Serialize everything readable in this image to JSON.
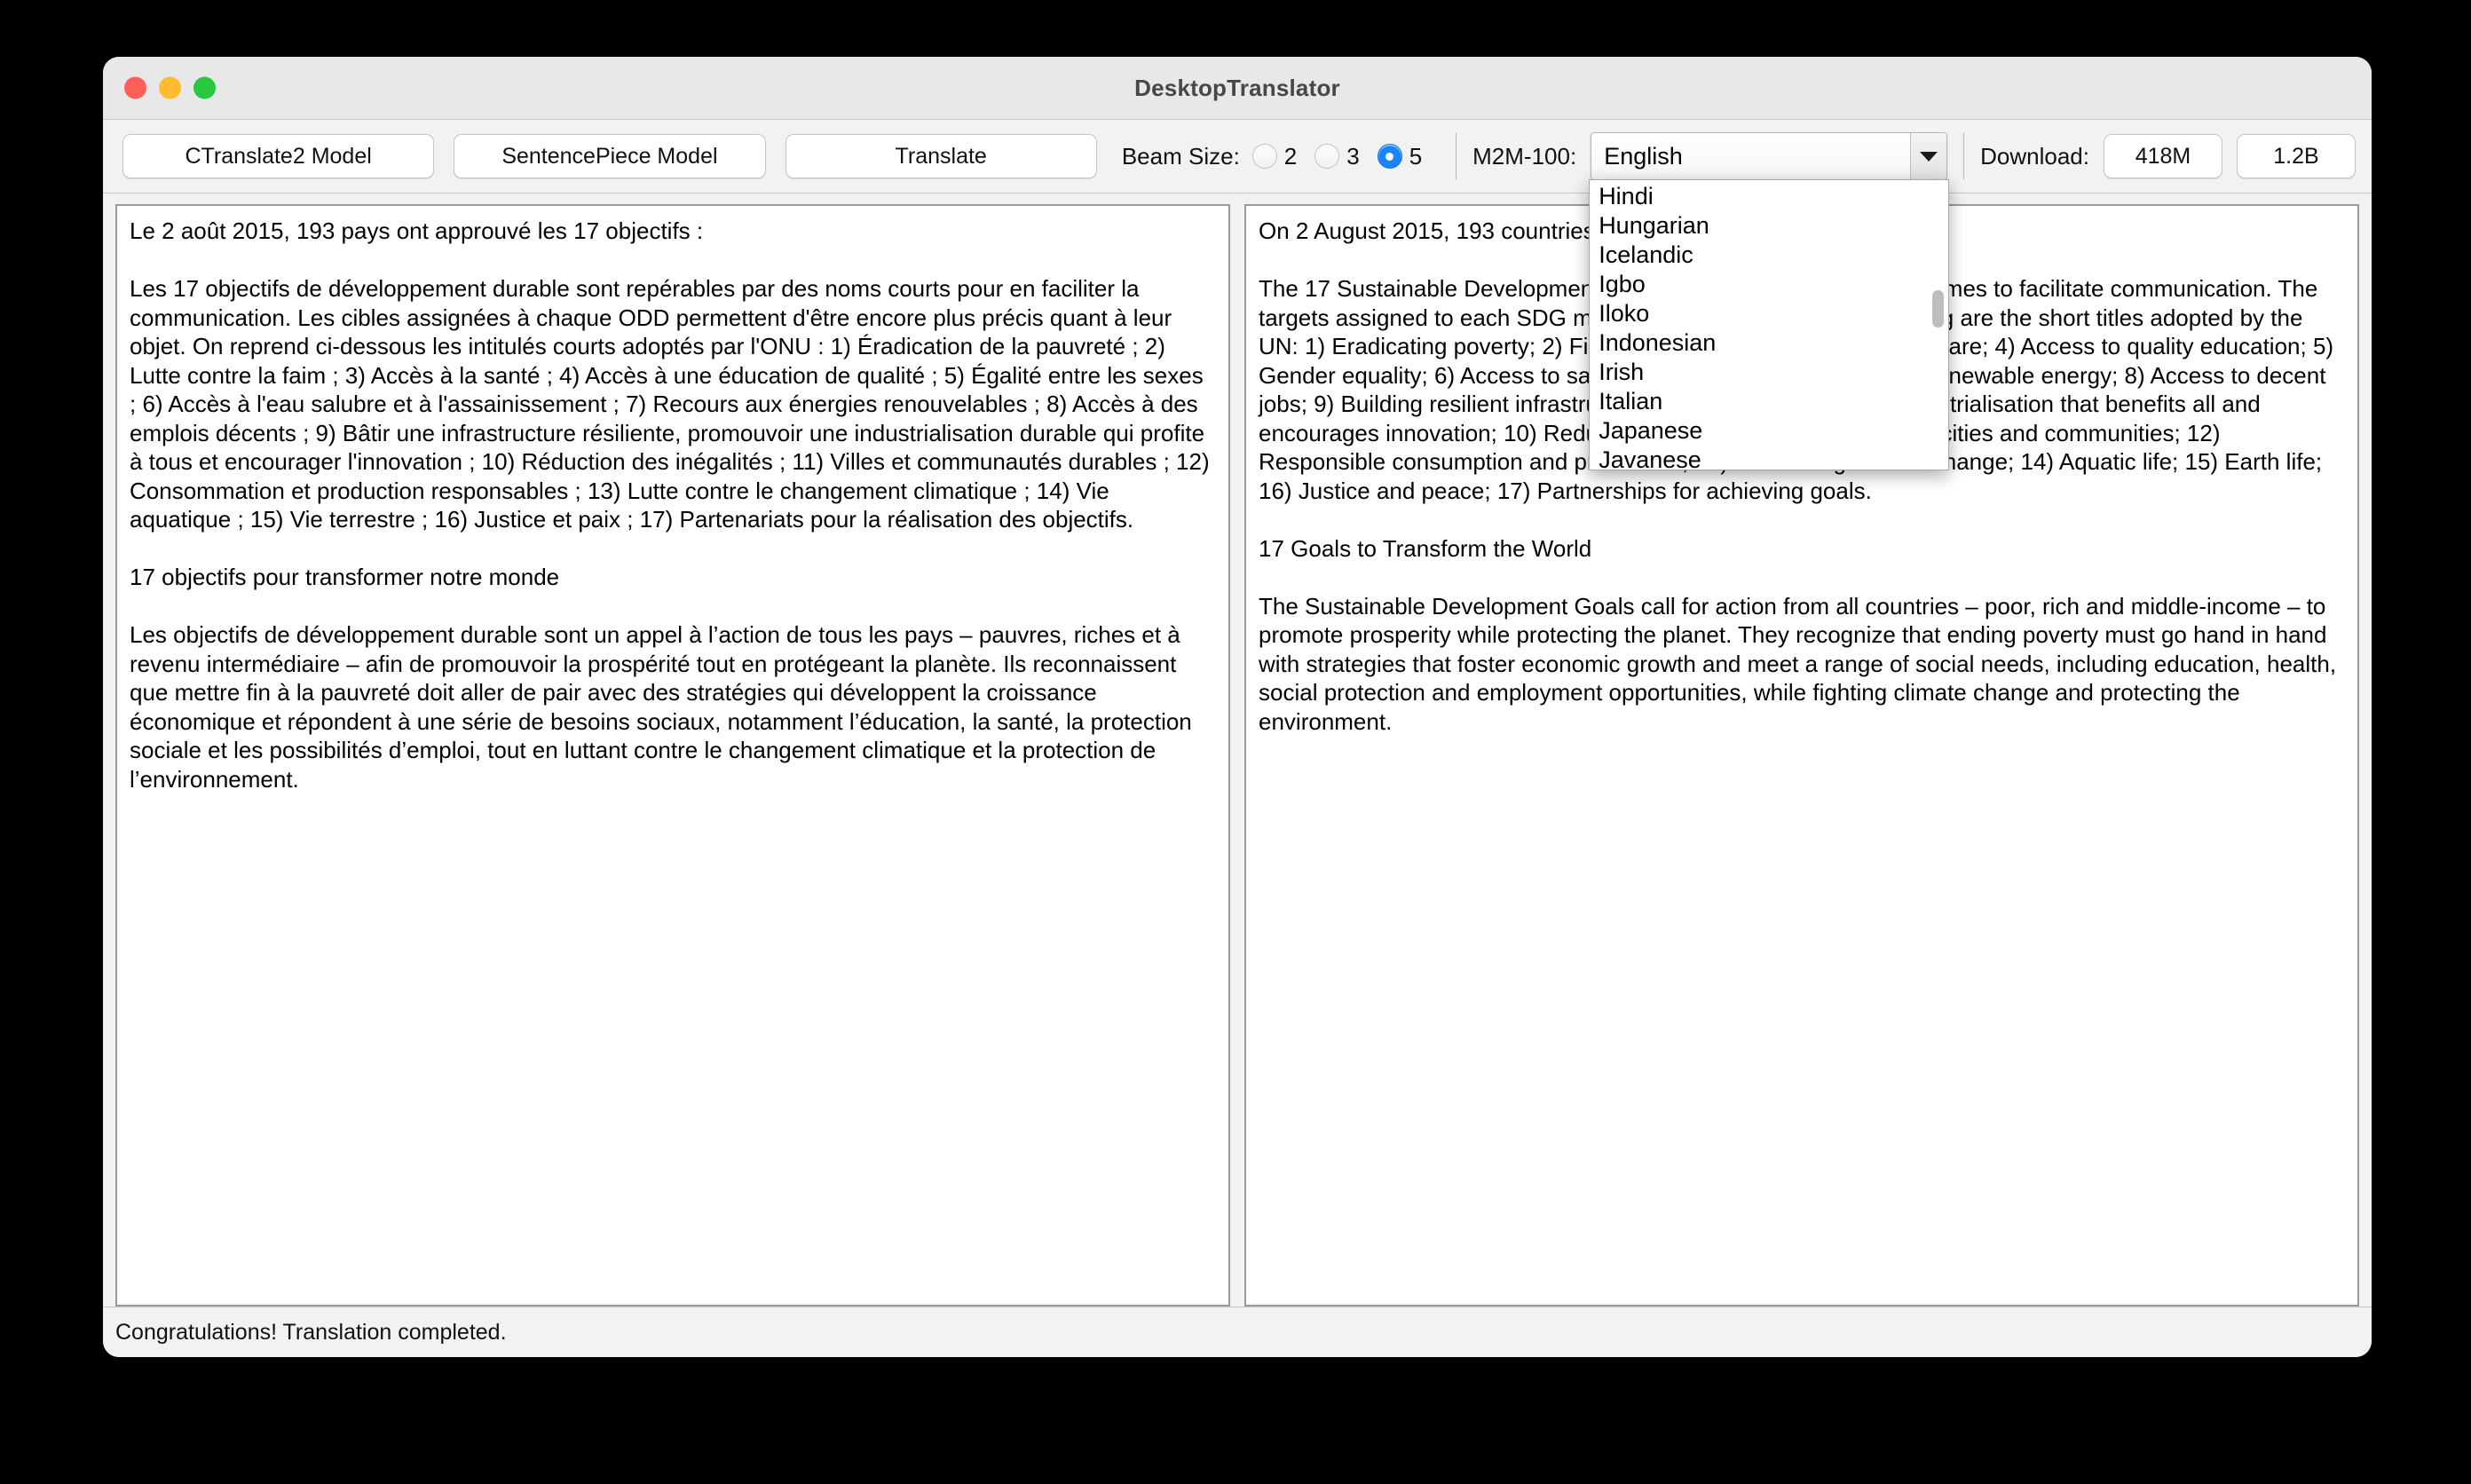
{
  "window": {
    "title": "DesktopTranslator",
    "traffic_lights": [
      "close",
      "minimize",
      "zoom"
    ]
  },
  "toolbar": {
    "ctranslate2_button": "CTranslate2 Model",
    "sentencepiece_button": "SentencePiece Model",
    "translate_button": "Translate",
    "beam_size_label": "Beam Size:",
    "beam_options": [
      {
        "value": "2",
        "selected": false
      },
      {
        "value": "3",
        "selected": false
      },
      {
        "value": "5",
        "selected": true
      }
    ],
    "m2m_label": "M2M-100:",
    "language_selected": "English",
    "download_label": "Download:",
    "download_buttons": [
      "418M",
      "1.2B"
    ],
    "accent_color": "#1a84ff"
  },
  "language_dropdown": {
    "open": true,
    "visible_items": [
      "Hindi",
      "Hungarian",
      "Icelandic",
      "Igbo",
      "Iloko",
      "Indonesian",
      "Irish",
      "Italian",
      "Japanese",
      "Javanese"
    ]
  },
  "source_panel": {
    "name": "source-text",
    "language": "French",
    "text": "Le 2 août 2015, 193 pays ont approuvé les 17 objectifs :\n\nLes 17 objectifs de développement durable sont repérables par des noms courts pour en faciliter la communication. Les cibles assignées à chaque ODD permettent d'être encore plus précis quant à leur objet. On reprend ci-dessous les intitulés courts adoptés par l'ONU : 1) Éradication de la pauvreté ; 2) Lutte contre la faim ; 3) Accès à la santé ; 4) Accès à une éducation de qualité ; 5) Égalité entre les sexes ; 6) Accès à l'eau salubre et à l'assainissement ; 7) Recours aux énergies renouvelables ; 8) Accès à des emplois décents ; 9) Bâtir une infrastructure résiliente, promouvoir une industrialisation durable qui profite à tous et encourager l'innovation ; 10) Réduction des inégalités ; 11) Villes et communautés durables ; 12) Consommation et production responsables ; 13) Lutte contre le changement climatique ; 14) Vie aquatique ; 15) Vie terrestre ; 16) Justice et paix ; 17) Partenariats pour la réalisation des objectifs.\n\n17 objectifs pour transformer notre monde\n\nLes objectifs de développement durable sont un appel à l’action de tous les pays – pauvres, riches et à revenu intermédiaire – afin de promouvoir la prospérité tout en protégeant la planète. Ils reconnaissent que mettre fin à la pauvreté doit aller de pair avec des stratégies qui développent la croissance économique et répondent à une série de besoins sociaux, notamment l’éducation, la santé, la protection sociale et les possibilités d’emploi, tout en luttant contre le changement climatique et la protection de l’environnement."
  },
  "target_panel": {
    "name": "translated-text",
    "language": "English",
    "text": "On 2 August 2015, 193 countries approved the 17 goals:\n\nThe 17 Sustainable Development Goals are identifiable by short names to facilitate communication. The targets assigned to each SDG make it even more precise. Following are the short titles adopted by the UN: 1) Eradicating poverty; 2) Fighting hunger; 3) Access to healthcare; 4) Access to quality education; 5) Gender equality; 6) Access to safe water and sanitation; 7) Using renewable energy; 8) Access to decent jobs; 9) Building resilient infrastructure, promoting sustainable industrialisation that benefits all and encourages innovation; 10) Reducing inequalities; 11) Sustainable cities and communities; 12) Responsible consumption and production; 13) Combating climate change; 14) Aquatic life; 15) Earth life; 16) Justice and peace; 17) Partnerships for achieving goals.\n\n17 Goals to Transform the World\n\nThe Sustainable Development Goals call for action from all countries – poor, rich and middle-income – to promote prosperity while protecting the planet. They recognize that ending poverty must go hand in hand with strategies that foster economic growth and meet a range of social needs, including education, health, social protection and employment opportunities, while fighting climate change and protecting the environment."
  },
  "status_bar": {
    "message": "Congratulations! Translation completed."
  }
}
